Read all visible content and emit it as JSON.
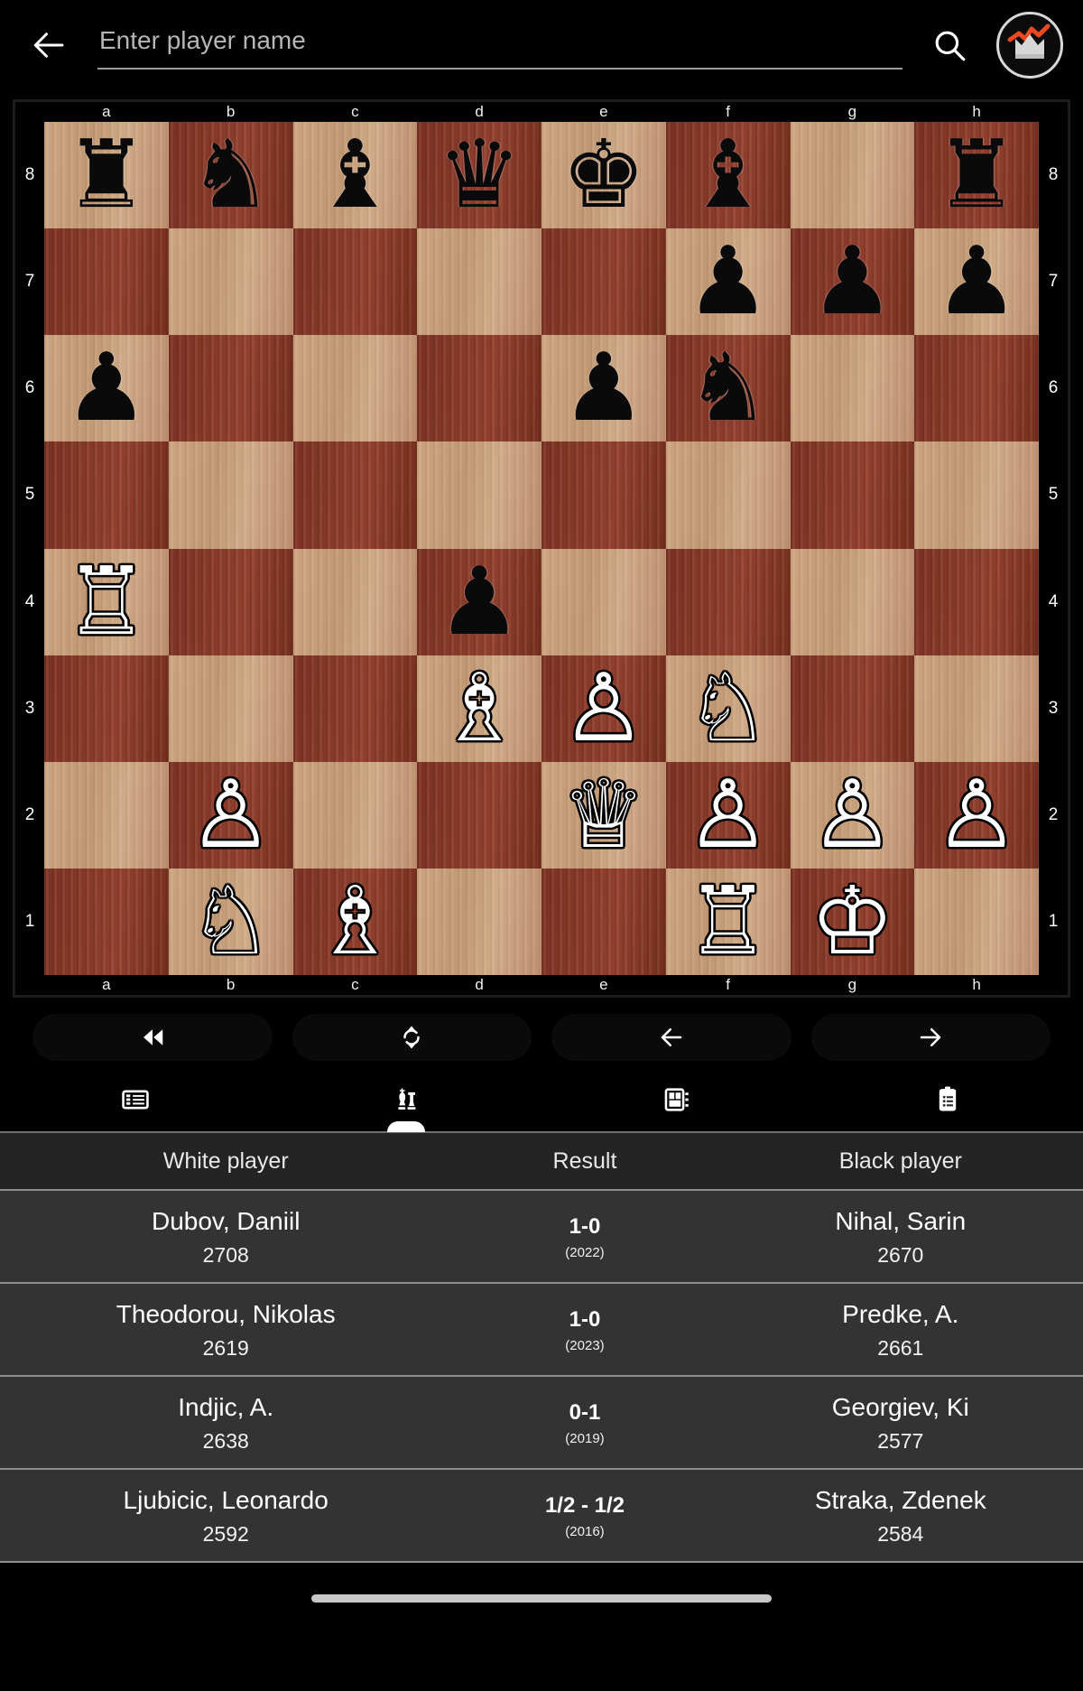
{
  "header": {
    "back_label": "Back",
    "search_placeholder": "Enter player name",
    "search_value": "",
    "search_icon": "search-icon",
    "avatar_icon": "crown-chart-avatar"
  },
  "board": {
    "files": [
      "a",
      "b",
      "c",
      "d",
      "e",
      "f",
      "g",
      "h"
    ],
    "ranks": [
      "8",
      "7",
      "6",
      "5",
      "4",
      "3",
      "2",
      "1"
    ],
    "light_color": "#c9a37e",
    "dark_color": "#8a3a2a",
    "position": [
      [
        "r",
        "n",
        "b",
        "q",
        "k",
        "b",
        "",
        "r"
      ],
      [
        "",
        "",
        "",
        "",
        "",
        "p",
        "p",
        "p"
      ],
      [
        "p",
        "",
        "",
        "",
        "p",
        "n",
        "",
        ""
      ],
      [
        "",
        "",
        "",
        "",
        "",
        "",
        "",
        ""
      ],
      [
        "R",
        "",
        "",
        "p",
        "",
        "",
        "",
        ""
      ],
      [
        "",
        "",
        "",
        "B",
        "P",
        "N",
        "",
        ""
      ],
      [
        "",
        "P",
        "",
        "",
        "Q",
        "P",
        "P",
        "P"
      ],
      [
        "",
        "N",
        "B",
        "",
        "",
        "R",
        "K",
        ""
      ]
    ]
  },
  "controls": [
    {
      "name": "rewind-to-start-button",
      "icon": "double-left-arrow-icon"
    },
    {
      "name": "flip-board-button",
      "icon": "refresh-circular-arrows-icon"
    },
    {
      "name": "previous-move-button",
      "icon": "left-arrow-icon"
    },
    {
      "name": "next-move-button",
      "icon": "right-arrow-icon"
    }
  ],
  "tabs": [
    {
      "name": "tab-moves-list",
      "icon": "list-icon",
      "active": false
    },
    {
      "name": "tab-games",
      "icon": "chess-pieces-icon",
      "active": true
    },
    {
      "name": "tab-board-panel",
      "icon": "board-panel-icon",
      "active": false
    },
    {
      "name": "tab-notes",
      "icon": "clipboard-icon",
      "active": false
    }
  ],
  "table": {
    "headers": {
      "white": "White player",
      "result": "Result",
      "black": "Black player"
    },
    "rows": [
      {
        "white_name": "Dubov, Daniil",
        "white_elo": "2708",
        "result": "1-0",
        "year": "(2022)",
        "black_name": "Nihal, Sarin",
        "black_elo": "2670"
      },
      {
        "white_name": "Theodorou, Nikolas",
        "white_elo": "2619",
        "result": "1-0",
        "year": "(2023)",
        "black_name": "Predke, A.",
        "black_elo": "2661"
      },
      {
        "white_name": "Indjic, A.",
        "white_elo": "2638",
        "result": "0-1",
        "year": "(2019)",
        "black_name": "Georgiev, Ki",
        "black_elo": "2577"
      },
      {
        "white_name": "Ljubicic, Leonardo",
        "white_elo": "2592",
        "result": "1/2 - 1/2",
        "year": "(2016)",
        "black_name": "Straka, Zdenek",
        "black_elo": "2584"
      }
    ]
  }
}
